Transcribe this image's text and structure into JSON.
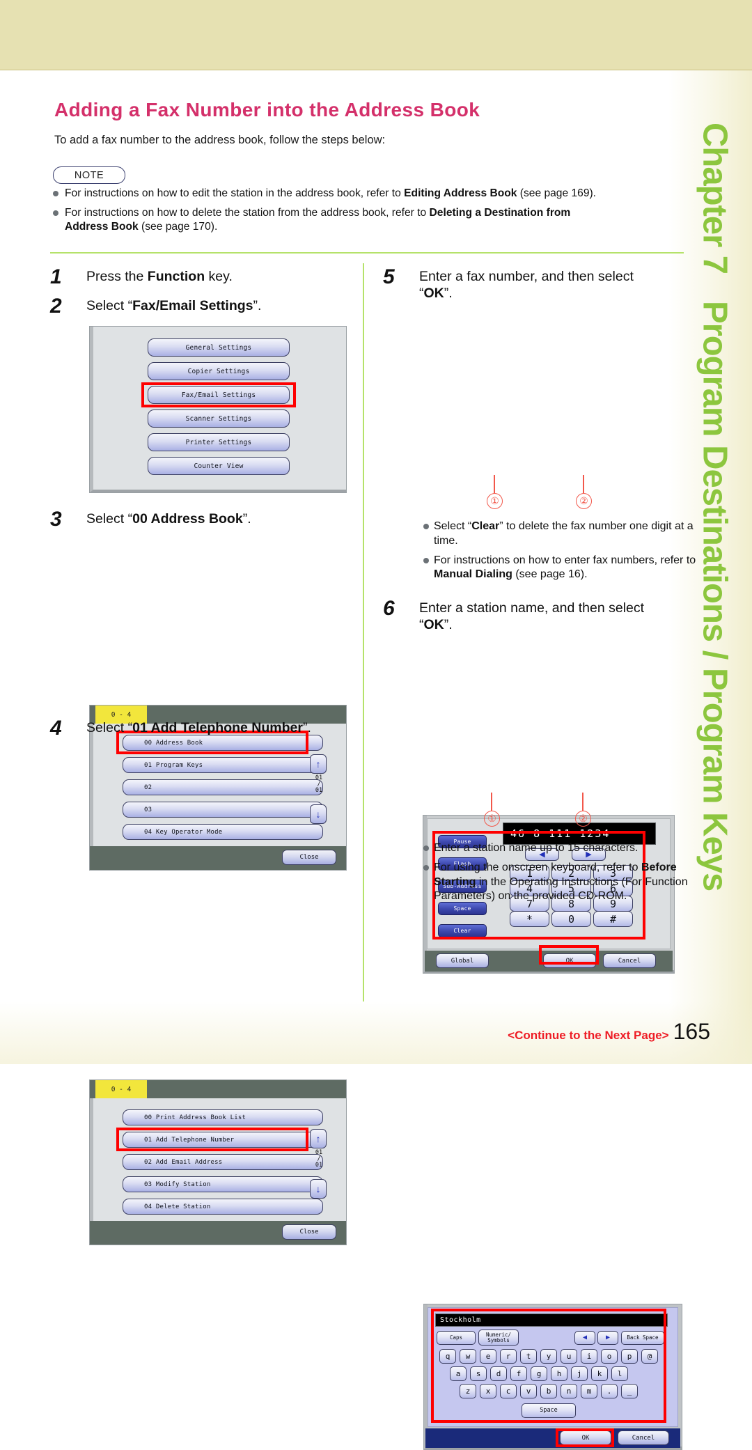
{
  "page": {
    "title": "Adding a Fax Number into the Address Book",
    "intro": "To add a fax number to the address book, follow the steps below:",
    "note_badge": "NOTE",
    "continue_label": "<Continue to the Next Page>",
    "page_number": "165",
    "title_color": "#d4306a",
    "accent_green": "#8cc63e",
    "highlight_red": "#fe0000"
  },
  "chapter": {
    "number": "Chapter 7",
    "subject": "Program Destinations / Program Keys"
  },
  "notes": [
    {
      "text_plain": "For instructions on how to edit the station in the address book, refer to Editing Address Book (see page 169)."
    },
    {
      "text_plain": "For instructions on how to delete the station from the address book, refer to Deleting a Destination from Address Book (see page 170)."
    }
  ],
  "steps": {
    "s1": {
      "num": "1",
      "text": "Press the Function key."
    },
    "s2": {
      "num": "2",
      "text": "Select “Fax/Email Settings”."
    },
    "s3": {
      "num": "3",
      "text": "Select “00 Address Book”."
    },
    "s4": {
      "num": "4",
      "text": "Select “01 Add Telephone Number”."
    },
    "s5": {
      "num": "5",
      "text": "Enter a fax number, and then select “OK”."
    },
    "s6": {
      "num": "6",
      "text": "Enter a station name, and then select “OK”."
    }
  },
  "screen_function_menu": {
    "buttons": [
      "General Settings",
      "Copier Settings",
      "Fax/Email Settings",
      "Scanner Settings",
      "Printer Settings",
      "Counter View"
    ],
    "highlighted": "Fax/Email Settings"
  },
  "screen_address_book_list": {
    "tab": "0 - 4",
    "rows": [
      "00  Address Book",
      "01  Program Keys",
      "02",
      "03",
      "04  Key Operator Mode"
    ],
    "highlighted": "00  Address Book",
    "pager_current": "01",
    "pager_sep": "/",
    "pager_total": "01",
    "close_label": "Close",
    "up_arrow": "↑",
    "down_arrow": "↓"
  },
  "screen_add_number_list": {
    "tab": "0 - 4",
    "rows": [
      "00  Print Address Book List",
      "01  Add Telephone Number",
      "02  Add Email Address",
      "03  Modify Station",
      "04  Delete Station"
    ],
    "highlighted": "01  Add Telephone Number",
    "pager_current": "01",
    "pager_sep": "/",
    "pager_total": "01",
    "close_label": "Close",
    "up_arrow": "↑",
    "down_arrow": "↓"
  },
  "screen_keypad": {
    "fax_number": "46 8 111 1234",
    "side_keys": [
      "Pause",
      "Flash",
      "Sub-Address",
      "Space",
      "Clear"
    ],
    "cursor_left": "◀",
    "cursor_right": "▶",
    "keys": [
      "1",
      "2",
      "3",
      "4",
      "5",
      "6",
      "7",
      "8",
      "9",
      "*",
      "0",
      "#"
    ],
    "global_label": "Global",
    "ok_label": "OK",
    "cancel_label": "Cancel",
    "callout_1": "①",
    "callout_2": "②"
  },
  "screen_keyboard": {
    "station_name": "Stockholm",
    "caps_label": "Caps",
    "numeric_label_line1": "Numeric/",
    "numeric_label_line2": "Symbols",
    "back_space_label": "Back Space",
    "cursor_left": "◀",
    "cursor_right": "▶",
    "row1": [
      "q",
      "w",
      "e",
      "r",
      "t",
      "y",
      "u",
      "i",
      "o",
      "p",
      "@"
    ],
    "row2": [
      "a",
      "s",
      "d",
      "f",
      "g",
      "h",
      "j",
      "k",
      "l"
    ],
    "row3": [
      "z",
      "x",
      "c",
      "v",
      "b",
      "n",
      "m",
      ".",
      "_"
    ],
    "space_label": "Space",
    "ok_label": "OK",
    "cancel_label": "Cancel",
    "callout_1": "①",
    "callout_2": "②"
  },
  "right_notes_after_step5": [
    {
      "text_plain": "Select “Clear” to delete the fax number one digit at a time."
    },
    {
      "text_plain": "For instructions on how to enter fax numbers, refer to Manual Dialing (see page 16)."
    }
  ],
  "right_notes_after_step6": [
    {
      "text_plain": "Enter a station name up to 15 characters."
    },
    {
      "text_plain": "For using the onscreen keyboard, refer to Before Starting in the Operating Instructions (For Function Parameters) on the provided CD-ROM."
    }
  ]
}
